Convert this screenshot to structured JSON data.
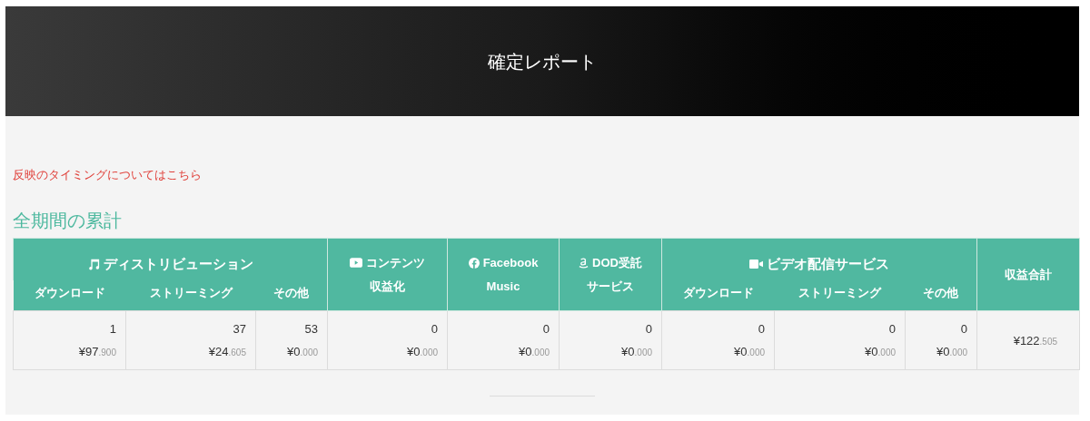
{
  "header": {
    "title": "確定レポート"
  },
  "notice_link": "反映のタイミングについてはこちら",
  "section_title": "全期間の累計",
  "table": {
    "groups": [
      {
        "label_lines": [
          "ディストリビューション"
        ],
        "subcolumns": [
          "ダウンロード",
          "ストリーミング",
          "その他"
        ]
      },
      {
        "label_lines": [
          "コンテンツ",
          "収益化"
        ]
      },
      {
        "label_lines": [
          "Facebook",
          "Music"
        ]
      },
      {
        "label_lines": [
          "DOD受託",
          "サービス"
        ]
      },
      {
        "label_lines": [
          "ビデオ配信サービス"
        ],
        "subcolumns": [
          "ダウンロード",
          "ストリーミング",
          "その他"
        ]
      }
    ],
    "total_label": "収益合計",
    "rows": [
      {
        "cells": [
          {
            "count": "1",
            "amount": "¥97",
            "decimals": ".900"
          },
          {
            "count": "37",
            "amount": "¥24",
            "decimals": ".605"
          },
          {
            "count": "53",
            "amount": "¥0",
            "decimals": ".000"
          },
          {
            "count": "0",
            "amount": "¥0",
            "decimals": ".000"
          },
          {
            "count": "0",
            "amount": "¥0",
            "decimals": ".000"
          },
          {
            "count": "0",
            "amount": "¥0",
            "decimals": ".000"
          },
          {
            "count": "0",
            "amount": "¥0",
            "decimals": ".000"
          },
          {
            "count": "0",
            "amount": "¥0",
            "decimals": ".000"
          },
          {
            "count": "0",
            "amount": "¥0",
            "decimals": ".000"
          }
        ],
        "total": {
          "amount": "¥122",
          "decimals": ".505"
        }
      }
    ]
  }
}
